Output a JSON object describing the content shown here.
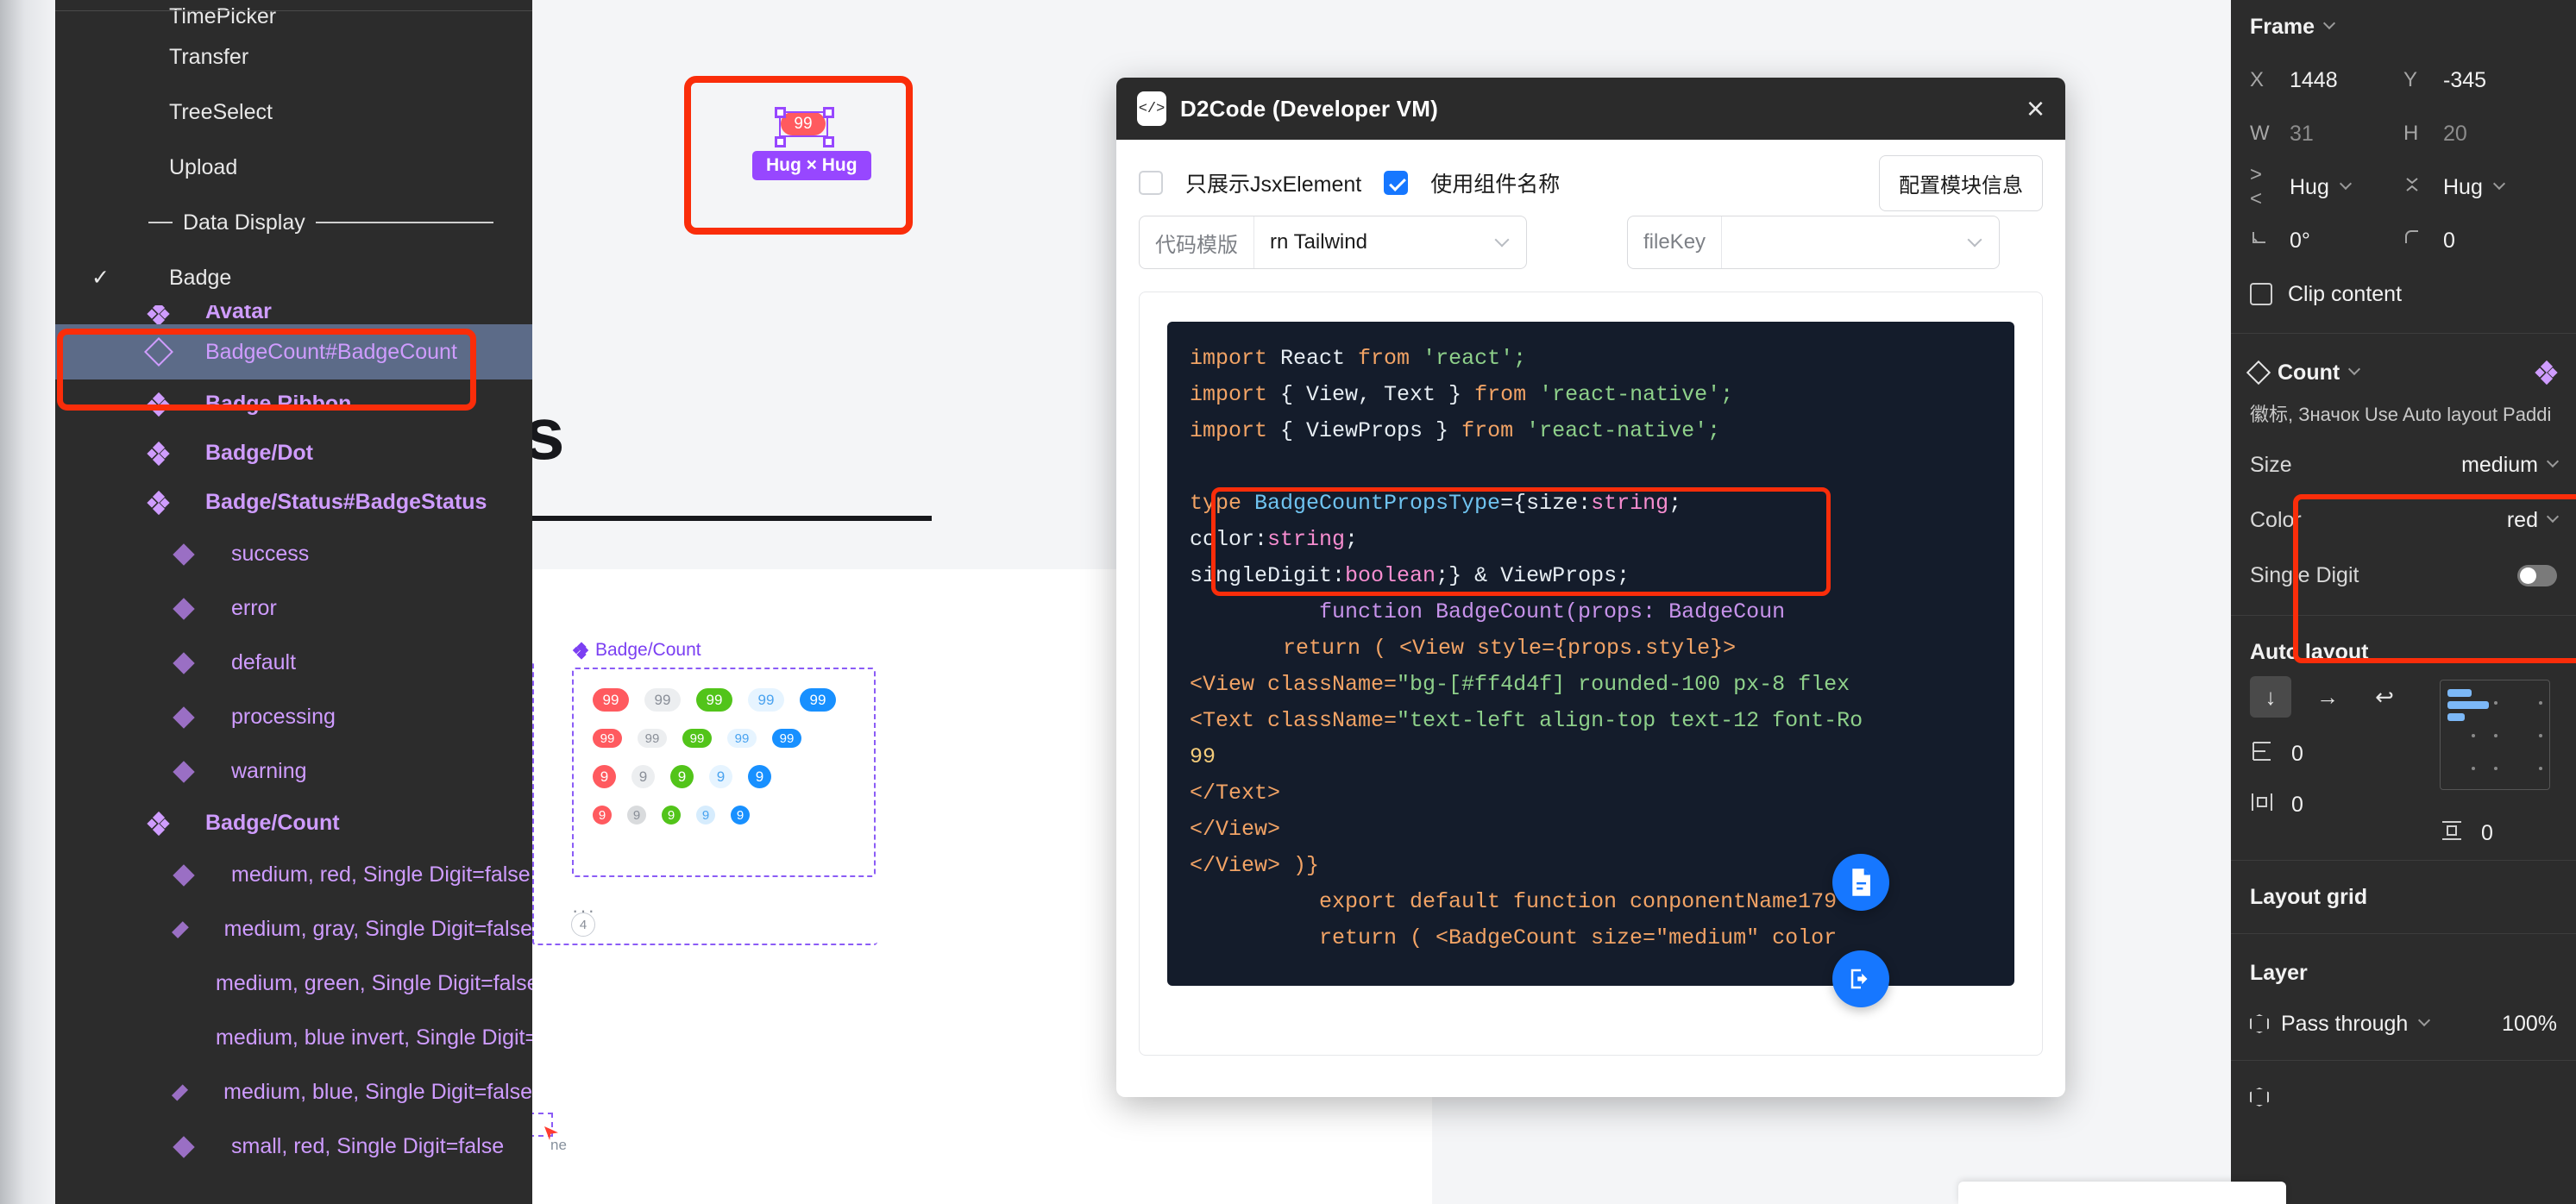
{
  "canvas": {
    "heading": "ponents",
    "selected_frame": {
      "badge_text": "99",
      "size_label": "Hug × Hug"
    },
    "component_set": {
      "title": "Badge/Count",
      "ellipsis": "···",
      "count": "4",
      "rows": [
        {
          "variant": "medium",
          "single_digit": "false",
          "badges": [
            {
              "text": "99",
              "bg": "#ff5a5f",
              "fg": "#ffffff"
            },
            {
              "text": "99",
              "bg": "#eceef0",
              "fg": "#8a8f98"
            },
            {
              "text": "99",
              "bg": "#52c41a",
              "fg": "#ffffff"
            },
            {
              "text": "99",
              "bg": "#e6f4ff",
              "fg": "#4aa3f0"
            },
            {
              "text": "99",
              "bg": "#1890ff",
              "fg": "#ffffff"
            }
          ]
        },
        {
          "variant": "small",
          "single_digit": "false",
          "badges": [
            {
              "text": "99",
              "bg": "#ff5a5f",
              "fg": "#ffffff"
            },
            {
              "text": "99",
              "bg": "#eceef0",
              "fg": "#8a8f98"
            },
            {
              "text": "99",
              "bg": "#52c41a",
              "fg": "#ffffff"
            },
            {
              "text": "99",
              "bg": "#e6f4ff",
              "fg": "#4aa3f0"
            },
            {
              "text": "99",
              "bg": "#1890ff",
              "fg": "#ffffff"
            }
          ]
        },
        {
          "variant": "medium",
          "single_digit": "true",
          "badges": [
            {
              "text": "9",
              "bg": "#ff5a5f",
              "fg": "#ffffff"
            },
            {
              "text": "9",
              "bg": "#eceef0",
              "fg": "#8a8f98"
            },
            {
              "text": "9",
              "bg": "#52c41a",
              "fg": "#ffffff"
            },
            {
              "text": "9",
              "bg": "#e6f4ff",
              "fg": "#4aa3f0"
            },
            {
              "text": "9",
              "bg": "#1890ff",
              "fg": "#ffffff"
            }
          ]
        },
        {
          "variant": "small",
          "single_digit": "true",
          "badges": [
            {
              "text": "9",
              "bg": "#ff5a5f",
              "fg": "#ffffff"
            },
            {
              "text": "9",
              "bg": "#d9dbdd",
              "fg": "#8a8f98"
            },
            {
              "text": "9",
              "bg": "#52c41a",
              "fg": "#ffffff"
            },
            {
              "text": "9",
              "bg": "#d6ecfd",
              "fg": "#4aa3f0"
            },
            {
              "text": "9",
              "bg": "#1890ff",
              "fg": "#ffffff"
            }
          ]
        }
      ]
    },
    "tiny_label": "ne"
  },
  "sidebar": {
    "items": [
      {
        "label": "TimePicker",
        "type": "item",
        "checked": false,
        "clipped": true
      },
      {
        "label": "Transfer",
        "type": "item",
        "checked": false
      },
      {
        "label": "TreeSelect",
        "type": "item",
        "checked": false
      },
      {
        "label": "Upload",
        "type": "item",
        "checked": false
      },
      {
        "label": "Data Display",
        "type": "separator"
      },
      {
        "label": "Badge",
        "type": "item",
        "checked": true
      },
      {
        "label": "Avatar",
        "type": "component",
        "clipped": true
      },
      {
        "label": "BadgeCount#BadgeCount",
        "type": "instance",
        "selected": true
      },
      {
        "label": "Badge.Ribbon",
        "type": "component"
      },
      {
        "label": "Badge/Dot",
        "type": "component"
      },
      {
        "label": "Badge/Status#BadgeStatus",
        "type": "component"
      },
      {
        "label": "success",
        "type": "variant"
      },
      {
        "label": "error",
        "type": "variant"
      },
      {
        "label": "default",
        "type": "variant"
      },
      {
        "label": "processing",
        "type": "variant"
      },
      {
        "label": "warning",
        "type": "variant"
      },
      {
        "label": "Badge/Count",
        "type": "component"
      },
      {
        "label": "medium, red, Single Digit=false",
        "type": "variant"
      },
      {
        "label": "medium, gray, Single Digit=false",
        "type": "variant"
      },
      {
        "label": "medium, green, Single Digit=false",
        "type": "variant"
      },
      {
        "label": "medium, blue invert, Single Digit=false",
        "type": "variant"
      },
      {
        "label": "medium, blue, Single Digit=false",
        "type": "variant"
      },
      {
        "label": "small, red, Single Digit=false",
        "type": "variant"
      }
    ]
  },
  "modal": {
    "title": "D2Code (Developer VM)",
    "close_label": "×",
    "options": {
      "only_jsx_label": "只展示JsxElement",
      "only_jsx_checked": false,
      "use_component_name_label": "使用组件名称",
      "use_component_name_checked": true,
      "config_button": "配置模块信息"
    },
    "selects": {
      "template_prefix": "代码模版",
      "template_value": "rn Tailwind",
      "filekey_prefix": "fileKey",
      "filekey_value": ""
    },
    "code": {
      "line1_kw": "import",
      "line1_id": " React ",
      "line1_from": "from",
      "line1_str": " 'react';",
      "line2_kw": "import",
      "line2_id": " { View, Text } ",
      "line2_from": "from",
      "line2_str": " 'react-native';",
      "line3_kw": "import",
      "line3_id": " { ViewProps } ",
      "line3_from": "from",
      "line3_str": " 'react-native';",
      "type_kw": "type",
      "type_name": " BadgeCountPropsType",
      "type_eq": "={size:",
      "type_string1": "string",
      "type_semi1": ";",
      "color_key": "color:",
      "color_type": "string",
      "color_semi": ";",
      "sd_key": "singleDigit:",
      "sd_type": "boolean",
      "sd_rest": ";} & ViewProps;",
      "fn_line": "function BadgeCount(props: BadgeCoun",
      "return1": "return ( <View style={props.style}>",
      "view_line_tag": "<View className=",
      "view_line_str": "\"bg-[#ff4d4f] rounded-100 px-8 flex",
      "text_line_tag": "<Text className=",
      "text_line_str": "\"text-left align-top text-12 font-Ro",
      "value_99": "99",
      "close_text": "</Text>",
      "close_view1": "</View>",
      "close_view2": "</View> )}",
      "export_line": "export default function conponentName179",
      "last_line": "return ( <BadgeCount size=\"medium\" color"
    },
    "fab_copy_icon": "document-icon",
    "fab_export_icon": "export-icon"
  },
  "properties": {
    "frame": {
      "title": "Frame",
      "x_key": "X",
      "x_val": "1448",
      "y_key": "Y",
      "y_val": "-345",
      "w_key": "W",
      "w_val": "31",
      "h_key": "H",
      "h_val": "20",
      "hw_val": "Hug",
      "hh_val": "Hug",
      "rotation": "0°",
      "corner_radius": "0",
      "clip_content_label": "Clip content",
      "clip_content_checked": false
    },
    "component": {
      "title": "Count",
      "description": "徽标, Значок Use Auto layout Paddi",
      "props": [
        {
          "name": "Size",
          "value": "medium",
          "type": "select"
        },
        {
          "name": "Color",
          "value": "red",
          "type": "select"
        },
        {
          "name": "Single Digit",
          "value": "off",
          "type": "toggle"
        }
      ]
    },
    "auto_layout": {
      "title": "Auto layout",
      "direction": "vertical",
      "gap": "0",
      "padding_h": "0",
      "padding_v": "0"
    },
    "layout_grid": {
      "title": "Layout grid"
    },
    "layer": {
      "title": "Layer",
      "blend_mode": "Pass through",
      "opacity": "100%"
    }
  }
}
